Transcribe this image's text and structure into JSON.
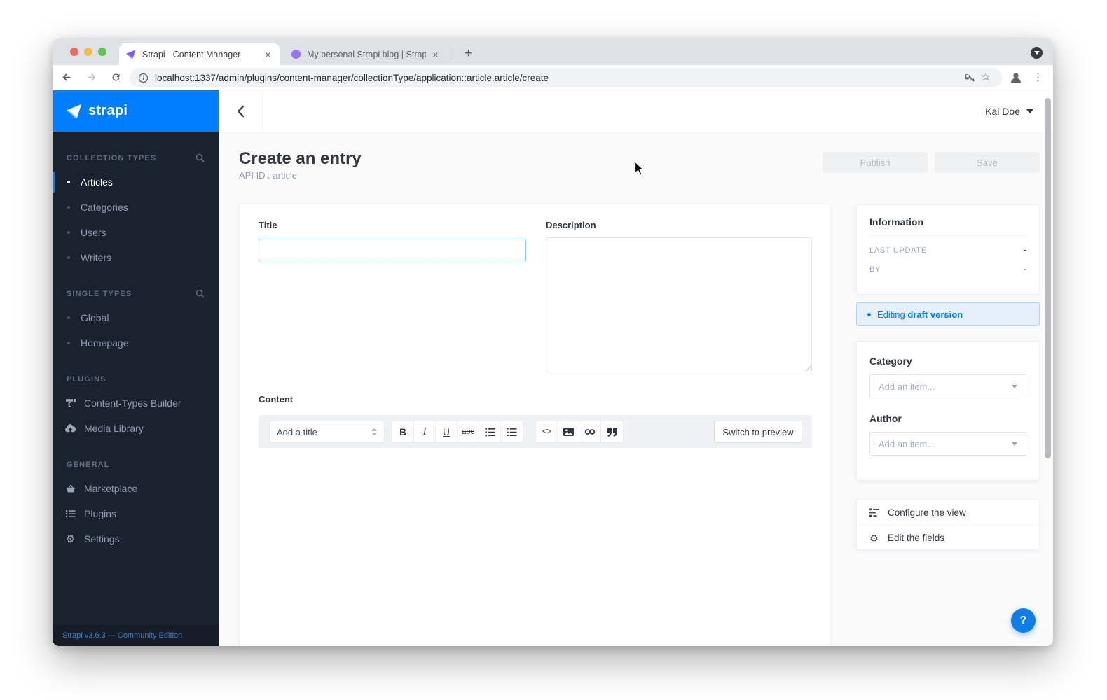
{
  "browser": {
    "tab1": {
      "title": "Strapi - Content Manager"
    },
    "tab2": {
      "title": "My personal Strapi blog | Strap"
    },
    "url": "localhost:1337/admin/plugins/content-manager/collectionType/application::article.article/create"
  },
  "icons": {
    "close": "×",
    "plus": "+",
    "kebab": "⋮",
    "star": "☆",
    "gear": "⚙",
    "help": "?"
  },
  "sidebar": {
    "logo_text": "strapi",
    "sections": [
      {
        "title": "COLLECTION TYPES",
        "items": [
          {
            "label": "Articles"
          },
          {
            "label": "Categories"
          },
          {
            "label": "Users"
          },
          {
            "label": "Writers"
          }
        ]
      },
      {
        "title": "SINGLE TYPES",
        "items": [
          {
            "label": "Global"
          },
          {
            "label": "Homepage"
          }
        ]
      },
      {
        "title": "PLUGINS",
        "items": [
          {
            "label": "Content-Types Builder"
          },
          {
            "label": "Media Library"
          }
        ]
      },
      {
        "title": "GENERAL",
        "items": [
          {
            "label": "Marketplace"
          },
          {
            "label": "Plugins"
          },
          {
            "label": "Settings"
          }
        ]
      }
    ],
    "footer": "Strapi v3.6.3 — Community Edition"
  },
  "topbar": {
    "user_name": "Kai Doe"
  },
  "page": {
    "title": "Create an entry",
    "api_id": "API ID : article",
    "publish": "Publish",
    "save": "Save"
  },
  "form": {
    "title_label": "Title",
    "description_label": "Description",
    "content_label": "Content",
    "editor": {
      "heading_select": "Add a title",
      "bold": "B",
      "italic": "I",
      "underline": "U",
      "strike": "abc",
      "code": "<>",
      "preview": "Switch to preview"
    }
  },
  "panel": {
    "information": {
      "title": "Information",
      "last_update_label": "LAST UPDATE",
      "last_update_value": "-",
      "by_label": "BY",
      "by_value": "-"
    },
    "draft_banner": {
      "prefix": "Editing",
      "bold": "draft version"
    },
    "category": {
      "label": "Category",
      "placeholder": "Add an item..."
    },
    "author": {
      "label": "Author",
      "placeholder": "Add an item..."
    },
    "links": [
      {
        "label": "Configure the view"
      },
      {
        "label": "Edit the fields"
      }
    ]
  },
  "colors": {
    "accent": "#007eff",
    "sidebar_bg": "#1b222f",
    "draft_bg": "#e6f0fb"
  }
}
